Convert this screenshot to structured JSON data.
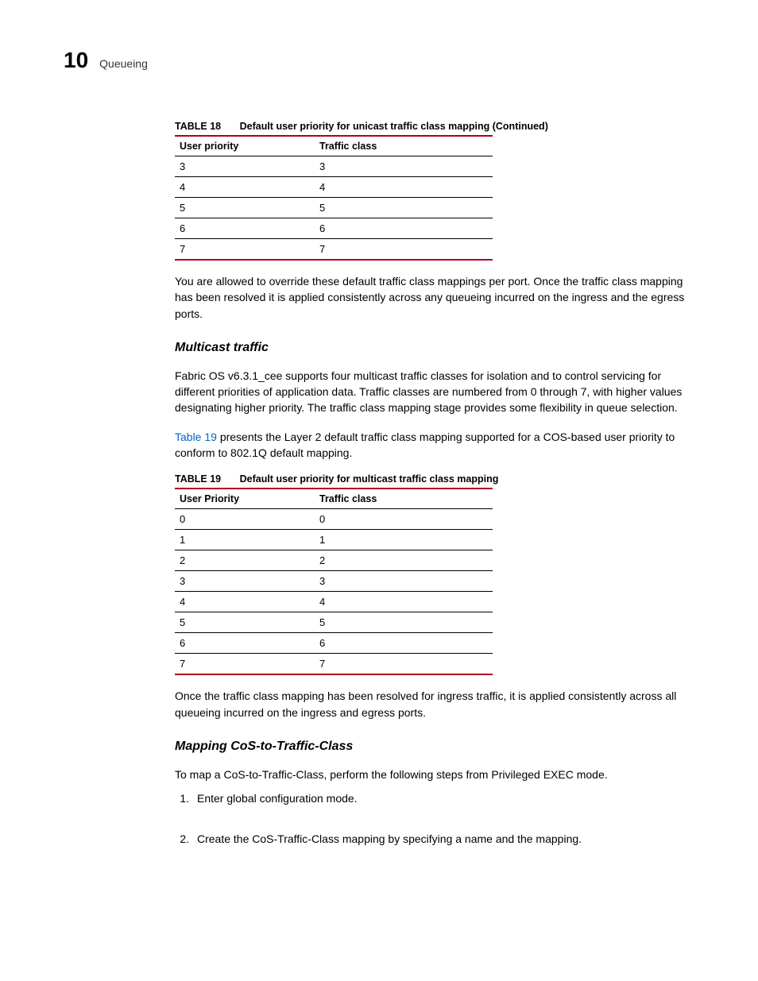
{
  "header": {
    "chapter_num": "10",
    "title": "Queueing"
  },
  "table18": {
    "label": "TABLE 18",
    "desc": "Default user priority for unicast traffic class mapping  (Continued)",
    "col1": "User priority",
    "col2": "Traffic class",
    "rows": [
      {
        "c1": "3",
        "c2": "3"
      },
      {
        "c1": "4",
        "c2": "4"
      },
      {
        "c1": "5",
        "c2": "5"
      },
      {
        "c1": "6",
        "c2": "6"
      },
      {
        "c1": "7",
        "c2": "7"
      }
    ]
  },
  "p_after_t18": "You are allowed to override these default traffic class mappings per port. Once the traffic class mapping has been resolved it is applied consistently across any queueing incurred on the ingress and the egress ports.",
  "h_multicast": "Multicast traffic",
  "p_multicast": "Fabric OS v6.3.1_cee supports four multicast traffic classes for isolation and to control servicing for different priorities of application data. Traffic classes are numbered from 0 through 7, with higher values designating higher priority. The traffic class mapping stage provides some flexibility in queue selection.",
  "p_t19_intro_link": "Table 19",
  "p_t19_intro_rest": " presents the Layer 2 default traffic class mapping supported for a COS-based user priority to conform to 802.1Q default mapping.",
  "table19": {
    "label": "TABLE 19",
    "desc": "Default user priority for multicast traffic class mapping",
    "col1": "User Priority",
    "col2": "Traffic class",
    "rows": [
      {
        "c1": "0",
        "c2": "0"
      },
      {
        "c1": "1",
        "c2": "1"
      },
      {
        "c1": "2",
        "c2": "2"
      },
      {
        "c1": "3",
        "c2": "3"
      },
      {
        "c1": "4",
        "c2": "4"
      },
      {
        "c1": "5",
        "c2": "5"
      },
      {
        "c1": "6",
        "c2": "6"
      },
      {
        "c1": "7",
        "c2": "7"
      }
    ]
  },
  "p_after_t19": "Once the traffic class mapping has been resolved for ingress traffic, it is applied consistently across all queueing incurred on the ingress and egress ports.",
  "h_mapping": "Mapping CoS-to-Traffic-Class",
  "p_mapping_intro": "To map a CoS-to-Traffic-Class, perform the following steps from Privileged EXEC mode.",
  "steps": {
    "s1": "Enter global configuration mode.",
    "s2": "Create the CoS-Traffic-Class mapping by specifying a name and the mapping."
  }
}
